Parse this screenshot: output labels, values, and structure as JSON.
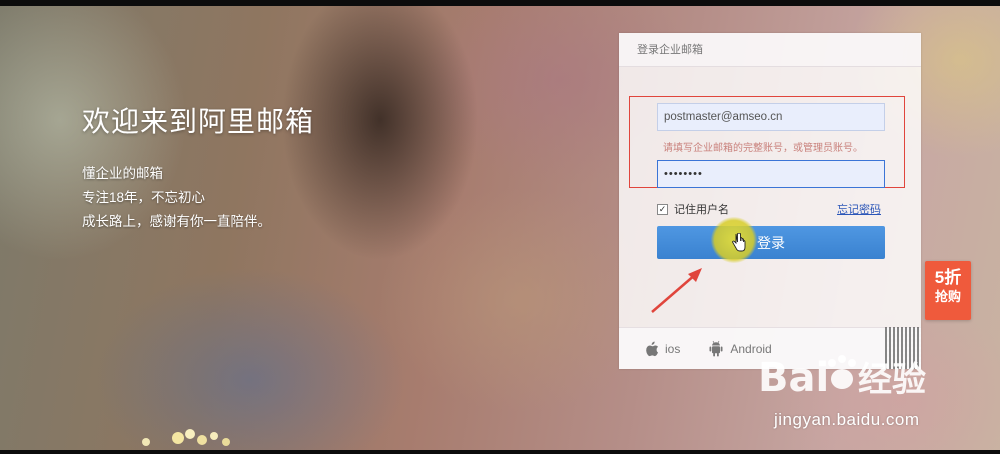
{
  "hero": {
    "title": "欢迎来到阿里邮箱",
    "lines": [
      "懂企业的邮箱",
      "专注18年，不忘初心",
      "成长路上，感谢有你一直陪伴。"
    ]
  },
  "login_panel": {
    "title": "登录企业邮箱",
    "username_value": "postmaster@amseo.cn",
    "hint": "请填写企业邮箱的完整账号，或管理员账号。",
    "password_mask": "••••••••",
    "remember_label": "记住用户名",
    "remember_checked": true,
    "forgot_label": "忘记密码",
    "login_label": "登录",
    "apps": [
      {
        "label": "ios",
        "icon": "apple-icon"
      },
      {
        "label": "Android",
        "icon": "android-icon"
      }
    ],
    "qr_icon": "qr-code-icon"
  },
  "promo": {
    "top": "5折",
    "bottom": "抢购",
    "color": "#ef5a3c"
  },
  "watermark": {
    "brand": "Bai经验",
    "url": "jingyan.baidu.com"
  },
  "colors": {
    "accent": "#3a82d0",
    "highlight_box": "#e0453c",
    "cursor_halo": "#e1dc3c"
  }
}
